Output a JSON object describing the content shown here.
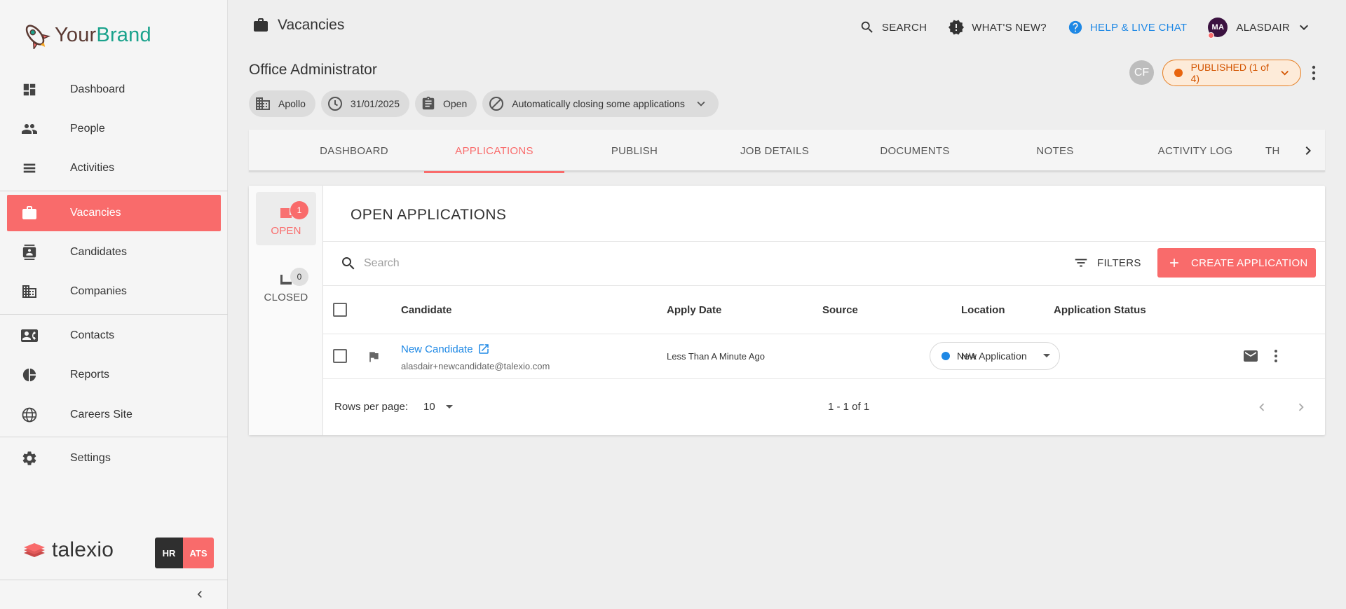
{
  "brand": {
    "name_part1": "Your",
    "name_part2": "Brand"
  },
  "sidebar": {
    "items": [
      {
        "label": "Dashboard",
        "icon": "dashboard-icon"
      },
      {
        "label": "People",
        "icon": "people-icon"
      },
      {
        "label": "Activities",
        "icon": "activities-icon"
      },
      {
        "label": "Vacancies",
        "icon": "briefcase-icon"
      },
      {
        "label": "Candidates",
        "icon": "candidate-icon"
      },
      {
        "label": "Companies",
        "icon": "company-icon"
      },
      {
        "label": "Contacts",
        "icon": "contacts-icon"
      },
      {
        "label": "Reports",
        "icon": "pie-chart-icon"
      },
      {
        "label": "Careers Site",
        "icon": "globe-icon"
      },
      {
        "label": "Settings",
        "icon": "gear-icon"
      }
    ],
    "active": "Vacancies",
    "footer_logo": "talexio",
    "module_hr": "HR",
    "module_ats": "ATS"
  },
  "topbar": {
    "section_title": "Vacancies",
    "search": "SEARCH",
    "whats_new": "WHAT'S NEW?",
    "help": "HELP & LIVE CHAT",
    "user_initials": "MA",
    "user_name": "ALASDAIR"
  },
  "vacancy": {
    "title": "Office Administrator",
    "chips": {
      "company": "Apollo",
      "date": "31/01/2025",
      "state": "Open",
      "closing": "Automatically closing some applications"
    },
    "owner_initials": "CF",
    "published_label": "PUBLISHED (1 of 4)"
  },
  "tabs": [
    "DASHBOARD",
    "APPLICATIONS",
    "PUBLISH",
    "JOB DETAILS",
    "DOCUMENTS",
    "NOTES",
    "ACTIVITY LOG",
    "TH"
  ],
  "active_tab": "APPLICATIONS",
  "side_tabs": {
    "open_label": "OPEN",
    "open_count": "1",
    "closed_label": "CLOSED",
    "closed_count": "0"
  },
  "panel": {
    "title": "OPEN APPLICATIONS",
    "search_placeholder": "Search",
    "filters_label": "FILTERS",
    "create_label": "CREATE APPLICATION"
  },
  "table": {
    "headers": [
      "Candidate",
      "Apply Date",
      "Source",
      "Location",
      "Application Status"
    ],
    "rows": [
      {
        "name": "New Candidate",
        "email": "alasdair+newcandidate@talexio.com",
        "apply_date": "Less Than A Minute Ago",
        "source": "",
        "location": "N/A",
        "status": "New Application"
      }
    ]
  },
  "pagination": {
    "rows_per_page_label": "Rows per page:",
    "rows_per_page": "10",
    "range": "1 - 1 of 1"
  },
  "colors": {
    "accent": "#f96b6b",
    "link": "#1e88e5",
    "published": "#e8650f",
    "brand_text": "#5b3a33",
    "brand_text_2": "#1aa28c"
  }
}
